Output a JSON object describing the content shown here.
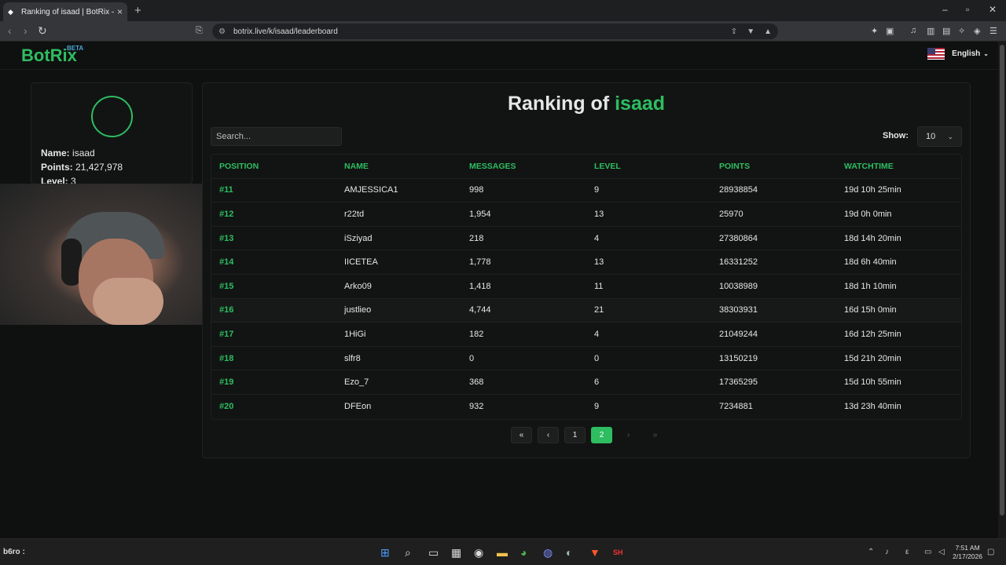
{
  "browser": {
    "tab_title": "Ranking of isaad | BotRix — Clo",
    "url": "botrix.live/k/isaad/leaderboard"
  },
  "site": {
    "logo": "BotRix",
    "logo_badge": "BETA",
    "language": "English"
  },
  "profile": {
    "name_label": "Name:",
    "name_value": "isaad",
    "points_label": "Points:",
    "points_value": "21,427,978",
    "level_label": "Level:",
    "level_value": "3"
  },
  "leaderboard": {
    "title_prefix": "Ranking of",
    "title_user": "isaad",
    "search_placeholder": "Search...",
    "show_label": "Show:",
    "show_value": "10",
    "columns": [
      "POSITION",
      "NAME",
      "MESSAGES",
      "LEVEL",
      "POINTS",
      "WATCHTIME"
    ],
    "rows": [
      {
        "position": "#11",
        "name": "AMJESSICA1",
        "messages": "998",
        "level": "9",
        "points": "28938854",
        "watchtime": "19d 10h 25min"
      },
      {
        "position": "#12",
        "name": "r22td",
        "messages": "1,954",
        "level": "13",
        "points": "25970",
        "watchtime": "19d 0h 0min"
      },
      {
        "position": "#13",
        "name": "iSziyad",
        "messages": "218",
        "level": "4",
        "points": "27380864",
        "watchtime": "18d 14h 20min"
      },
      {
        "position": "#14",
        "name": "IICETEA",
        "messages": "1,778",
        "level": "13",
        "points": "16331252",
        "watchtime": "18d 6h 40min"
      },
      {
        "position": "#15",
        "name": "Arko09",
        "messages": "1,418",
        "level": "11",
        "points": "10038989",
        "watchtime": "18d 1h 10min"
      },
      {
        "position": "#16",
        "name": "justlieo",
        "messages": "4,744",
        "level": "21",
        "points": "38303931",
        "watchtime": "16d 15h 0min"
      },
      {
        "position": "#17",
        "name": "1HiGi",
        "messages": "182",
        "level": "4",
        "points": "21049244",
        "watchtime": "16d 12h 25min"
      },
      {
        "position": "#18",
        "name": "slfr8",
        "messages": "0",
        "level": "0",
        "points": "13150219",
        "watchtime": "15d 21h 20min"
      },
      {
        "position": "#19",
        "name": "Ezo_7",
        "messages": "368",
        "level": "6",
        "points": "17365295",
        "watchtime": "15d 10h 55min"
      },
      {
        "position": "#20",
        "name": "DFEon",
        "messages": "932",
        "level": "9",
        "points": "7234881",
        "watchtime": "13d 23h 40min"
      }
    ],
    "pagination": {
      "first": "«",
      "prev": "‹",
      "pages": [
        "1",
        "2"
      ],
      "current": "2",
      "next": "›",
      "last": "»"
    }
  },
  "taskbar": {
    "user": "b6ro :",
    "time": "7:51 AM",
    "date": "2/17/2026"
  },
  "colors": {
    "accent": "#2ebd61",
    "background": "#0f1110",
    "panel": "#121413"
  }
}
